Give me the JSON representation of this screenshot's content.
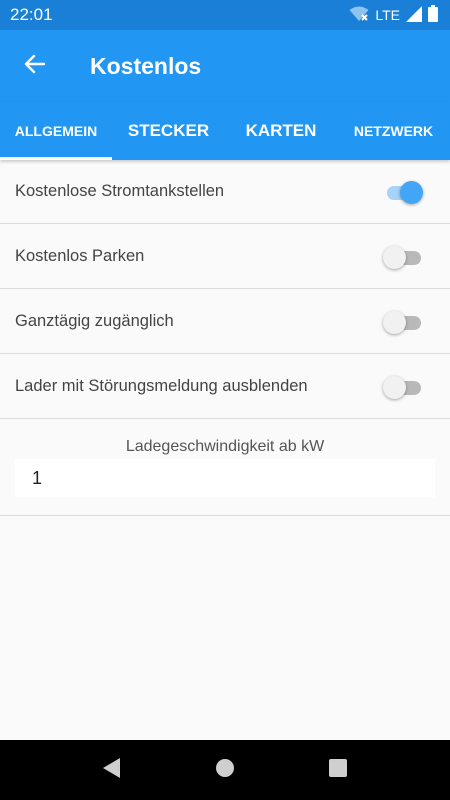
{
  "status_bar": {
    "time": "22:01",
    "network_label": "LTE",
    "icons": [
      "wifi-off-icon",
      "signal-icon",
      "battery-icon"
    ]
  },
  "app_bar": {
    "title": "Kostenlos",
    "back_icon": "arrow-left-icon"
  },
  "tabs": [
    {
      "label": "ALLGEMEIN",
      "active": true
    },
    {
      "label": "STECKER",
      "active": false
    },
    {
      "label": "KARTEN",
      "active": false
    },
    {
      "label": "NETZWERK",
      "active": false
    }
  ],
  "settings": [
    {
      "label": "Kostenlose Stromtankstellen",
      "checked": true
    },
    {
      "label": "Kostenlos Parken",
      "checked": false
    },
    {
      "label": "Ganztägig zugänglich",
      "checked": false
    },
    {
      "label": "Lader mit Störungsmeldung ausblenden",
      "checked": false
    }
  ],
  "speed_filter": {
    "label": "Ladegeschwindigkeit ab kW",
    "value": "1"
  },
  "nav_bar": {
    "buttons": [
      "back-triangle-icon",
      "home-circle-icon",
      "recents-square-icon"
    ]
  },
  "colors": {
    "primary": "#2196f3",
    "status_bar": "#1a7fd6",
    "switch_on": "#42a5f5"
  }
}
